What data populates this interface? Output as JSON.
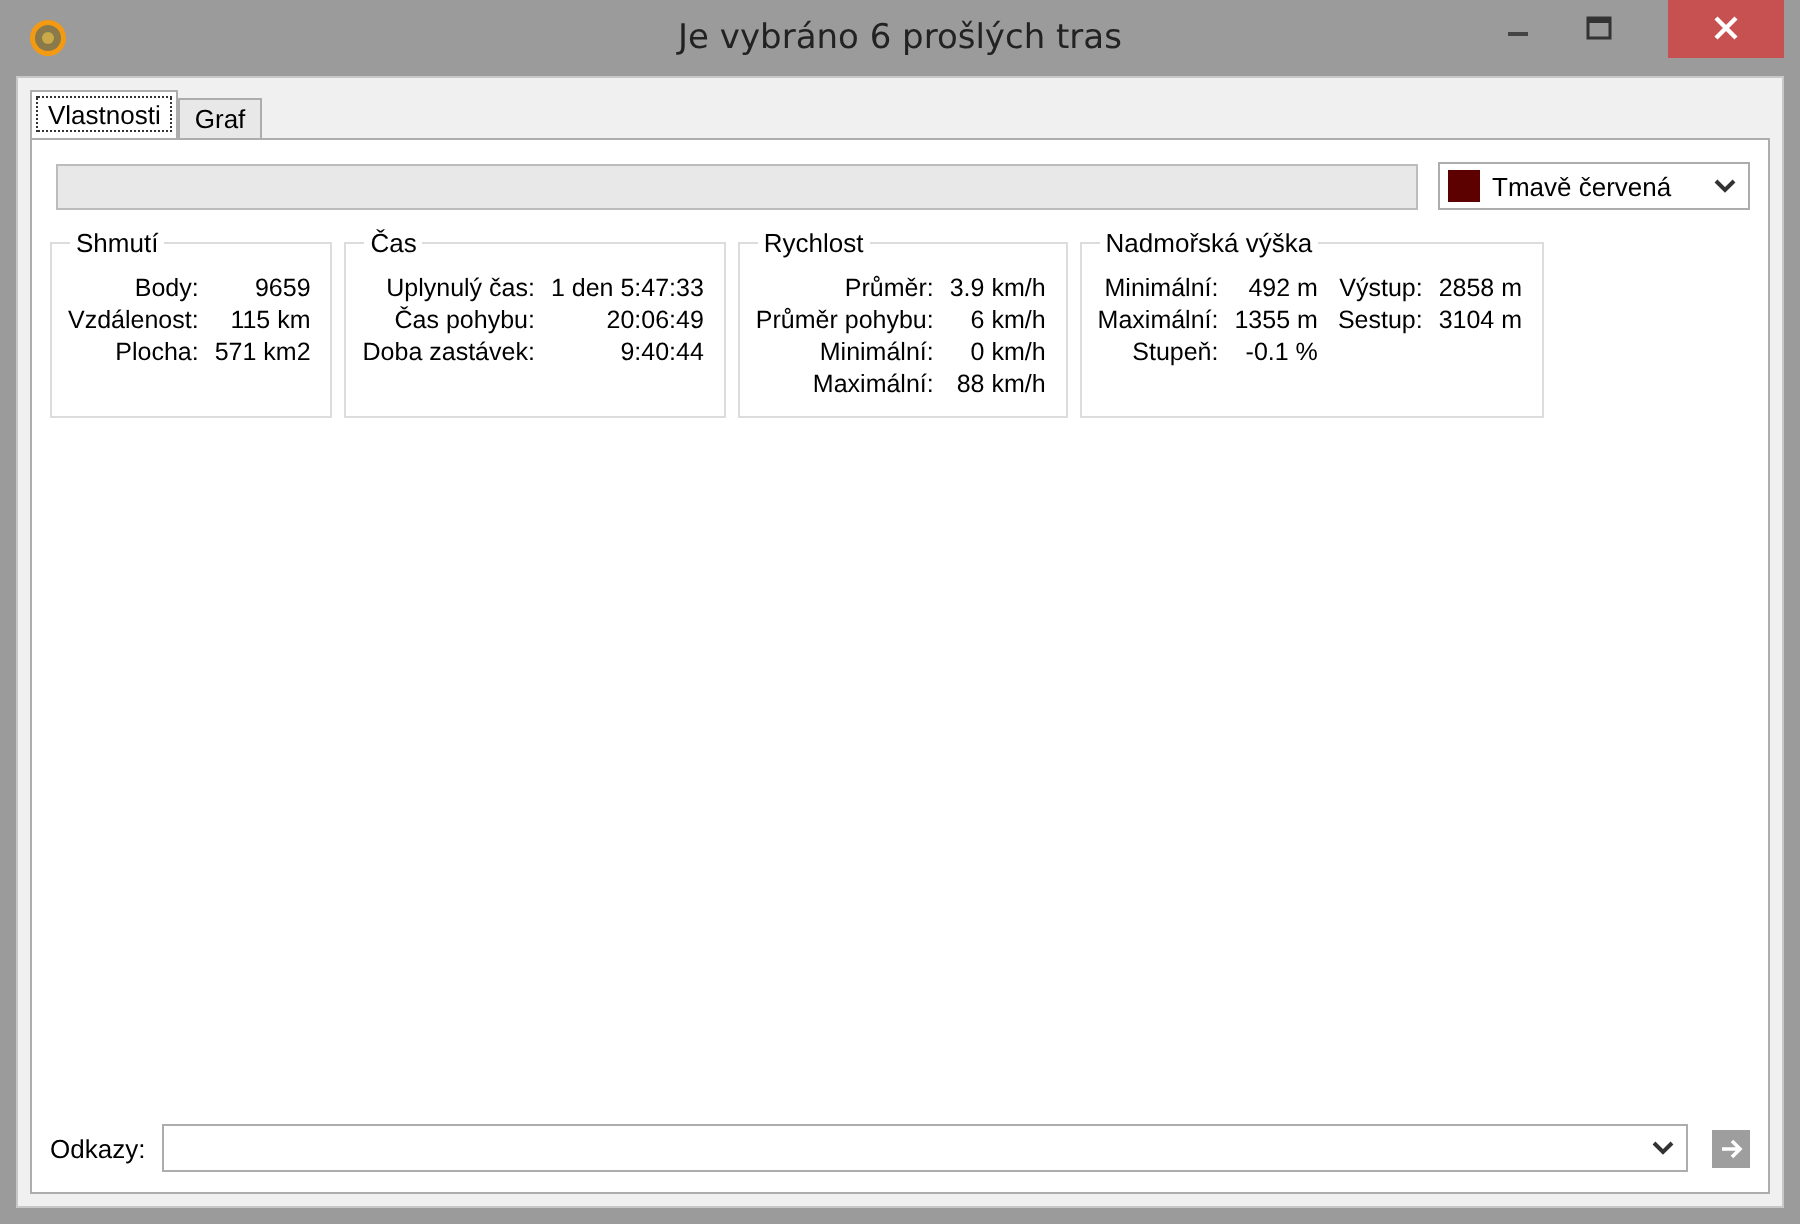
{
  "window": {
    "title": "Je vybráno 6 prošlých tras"
  },
  "tabs": [
    {
      "label": "Vlastnosti",
      "selected": true
    },
    {
      "label": "Graf",
      "selected": false
    }
  ],
  "color_dropdown": {
    "value": "Tmavě červená",
    "color": "#5c0000"
  },
  "groups": [
    {
      "title": "Shmutí",
      "columns": [
        [
          {
            "label": "Body:",
            "value": "9659"
          },
          {
            "label": "Vzdálenost:",
            "value": "115 km"
          },
          {
            "label": "Plocha:",
            "value": "571 km2"
          }
        ]
      ]
    },
    {
      "title": "Čas",
      "columns": [
        [
          {
            "label": "Uplynulý čas:",
            "value": "1 den 5:47:33"
          },
          {
            "label": "Čas pohybu:",
            "value": "20:06:49"
          },
          {
            "label": "Doba zastávek:",
            "value": "9:40:44"
          }
        ]
      ]
    },
    {
      "title": "Rychlost",
      "columns": [
        [
          {
            "label": "Průměr:",
            "value": "3.9 km/h"
          },
          {
            "label": "Průměr pohybu:",
            "value": "6 km/h"
          },
          {
            "label": "Minimální:",
            "value": "0 km/h"
          },
          {
            "label": "Maximální:",
            "value": "88 km/h"
          }
        ]
      ]
    },
    {
      "title": "Nadmořská výška",
      "columns": [
        [
          {
            "label": "Minimální:",
            "value": "492 m"
          },
          {
            "label": "Maximální:",
            "value": "1355 m"
          },
          {
            "label": "Stupeň:",
            "value": "-0.1 %"
          }
        ],
        [
          {
            "label": "Výstup:",
            "value": "2858 m"
          },
          {
            "label": "Sestup:",
            "value": "3104 m"
          }
        ]
      ]
    }
  ],
  "links": {
    "label": "Odkazy:",
    "go_disabled": true
  }
}
